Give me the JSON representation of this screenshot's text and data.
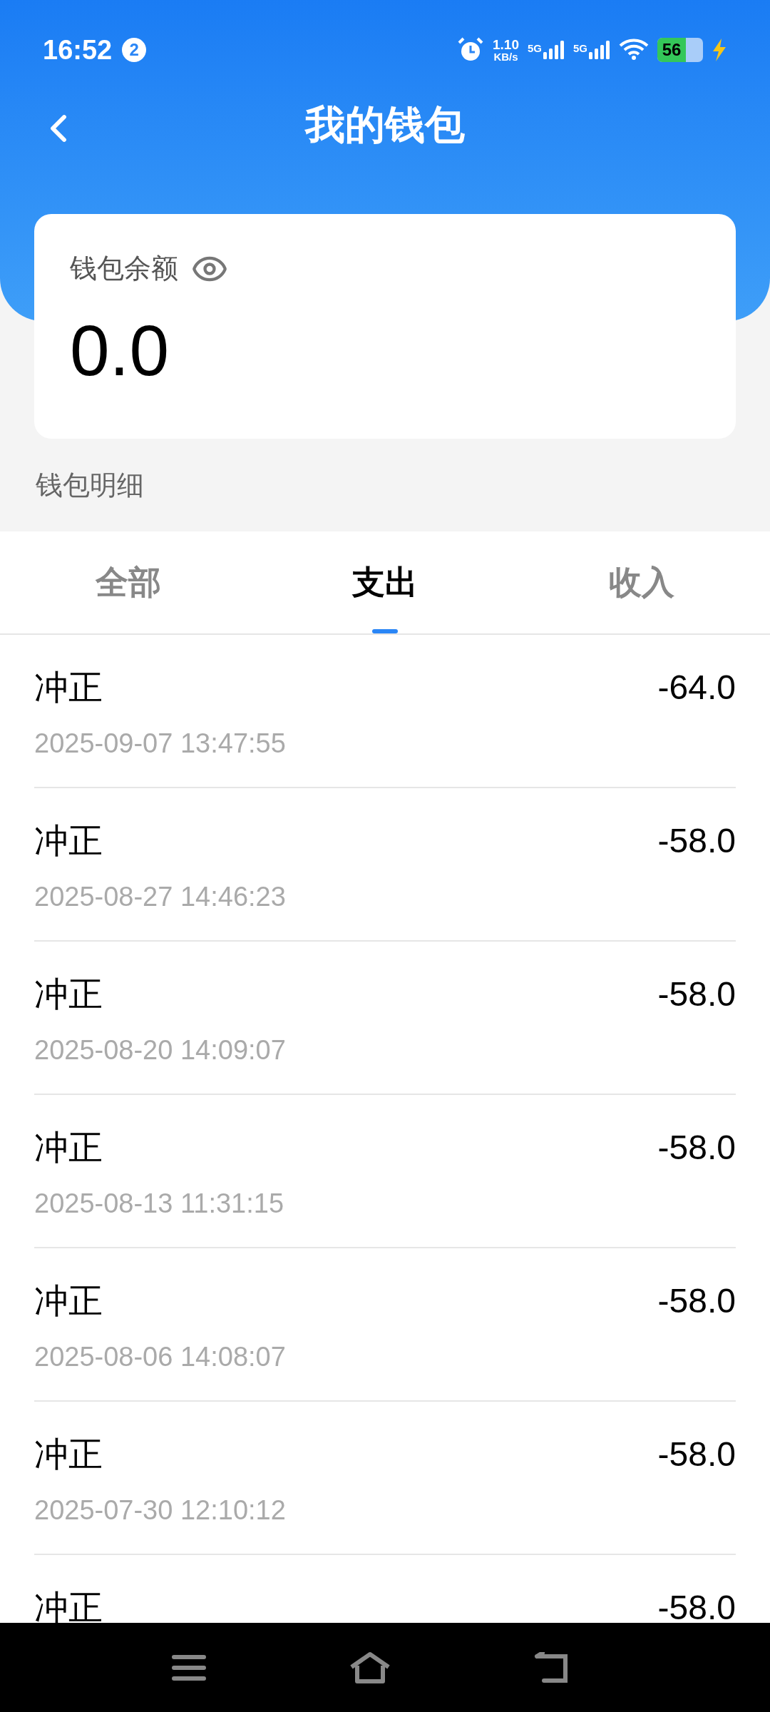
{
  "status_bar": {
    "time": "16:52",
    "notification_count": "2",
    "net_speed_value": "1.10",
    "net_speed_unit": "KB/s",
    "sim1": "5G",
    "sim2": "5G",
    "battery": "56"
  },
  "header": {
    "title": "我的钱包"
  },
  "balance_card": {
    "label": "钱包余额",
    "amount": "0.0"
  },
  "section_title": "钱包明细",
  "tabs": [
    {
      "label": "全部",
      "selected": false
    },
    {
      "label": "支出",
      "selected": true
    },
    {
      "label": "收入",
      "selected": false
    }
  ],
  "transactions": [
    {
      "title": "冲正",
      "amount": "-64.0",
      "time": "2025-09-07 13:47:55"
    },
    {
      "title": "冲正",
      "amount": "-58.0",
      "time": "2025-08-27 14:46:23"
    },
    {
      "title": "冲正",
      "amount": "-58.0",
      "time": "2025-08-20 14:09:07"
    },
    {
      "title": "冲正",
      "amount": "-58.0",
      "time": "2025-08-13 11:31:15"
    },
    {
      "title": "冲正",
      "amount": "-58.0",
      "time": "2025-08-06 14:08:07"
    },
    {
      "title": "冲正",
      "amount": "-58.0",
      "time": "2025-07-30 12:10:12"
    },
    {
      "title": "冲正",
      "amount": "-58.0"
    }
  ]
}
